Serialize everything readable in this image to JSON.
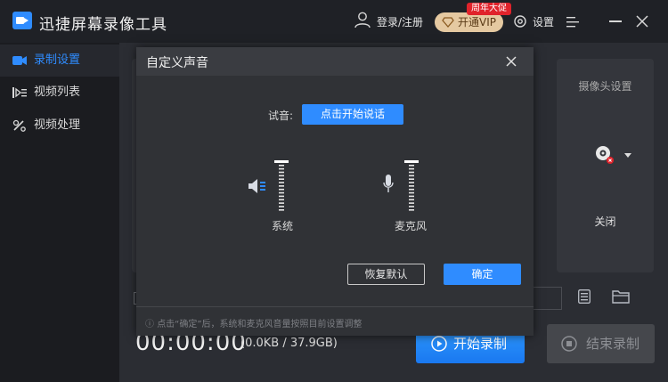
{
  "app": {
    "title": "迅捷屏幕录像工具",
    "login": "登录/注册",
    "promo": "周年大促",
    "vip": "开通VIP",
    "settings": "设置"
  },
  "sidebar": {
    "items": [
      {
        "label": "录制设置",
        "active": true
      },
      {
        "label": "视频列表",
        "active": false
      },
      {
        "label": "视频处理",
        "active": false
      }
    ]
  },
  "camera": {
    "title": "摄像头设置",
    "status": "关闭"
  },
  "bottom": {
    "timer": "00:00:00",
    "storage": "(0.0KB / 37.9GB)",
    "start": "开始录制",
    "stop": "结束录制"
  },
  "dialog": {
    "title": "自定义声音",
    "test_label": "试音:",
    "test_button": "点击开始说话",
    "system_label": "系统",
    "mic_label": "麦克风",
    "reset": "恢复默认",
    "confirm": "确定",
    "note": "点击“确定”后，系统和麦克风音量按照目前设置调整",
    "system_volume": 1.0,
    "mic_volume": 1.0
  },
  "colors": {
    "accent": "#2f8cff",
    "vip": "#e5c9a1",
    "promo": "#e0232b"
  }
}
